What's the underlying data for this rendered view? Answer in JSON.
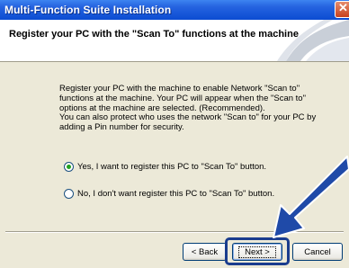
{
  "window": {
    "title": "Multi-Function Suite Installation",
    "close_glyph": "✕"
  },
  "header": {
    "title": "Register your PC with the \"Scan To\" functions at the machine"
  },
  "body": {
    "paragraph1": "Register your PC with the machine to enable Network \"Scan to\" functions at the machine. Your PC will appear when the \"Scan to\" options at the machine are selected. (Recommended).",
    "paragraph2": "You can also protect who uses the network \"Scan to\" for your PC by adding a Pin number for security."
  },
  "options": [
    {
      "label": "Yes, I want to register this PC to \"Scan To\" button.",
      "checked": true
    },
    {
      "label": "No, I don't want register this PC to \"Scan To\" button.",
      "checked": false
    }
  ],
  "buttons": {
    "back": "< Back",
    "next": "Next >",
    "cancel": "Cancel"
  },
  "colors": {
    "titlebar": "#0b4cd2",
    "dialog_bg": "#ece9d8",
    "callout_arrow": "#1f4aa8",
    "radio_dot": "#21a121"
  },
  "icons": [
    "close-icon",
    "header-swoosh-graphic",
    "callout-arrow-icon"
  ]
}
